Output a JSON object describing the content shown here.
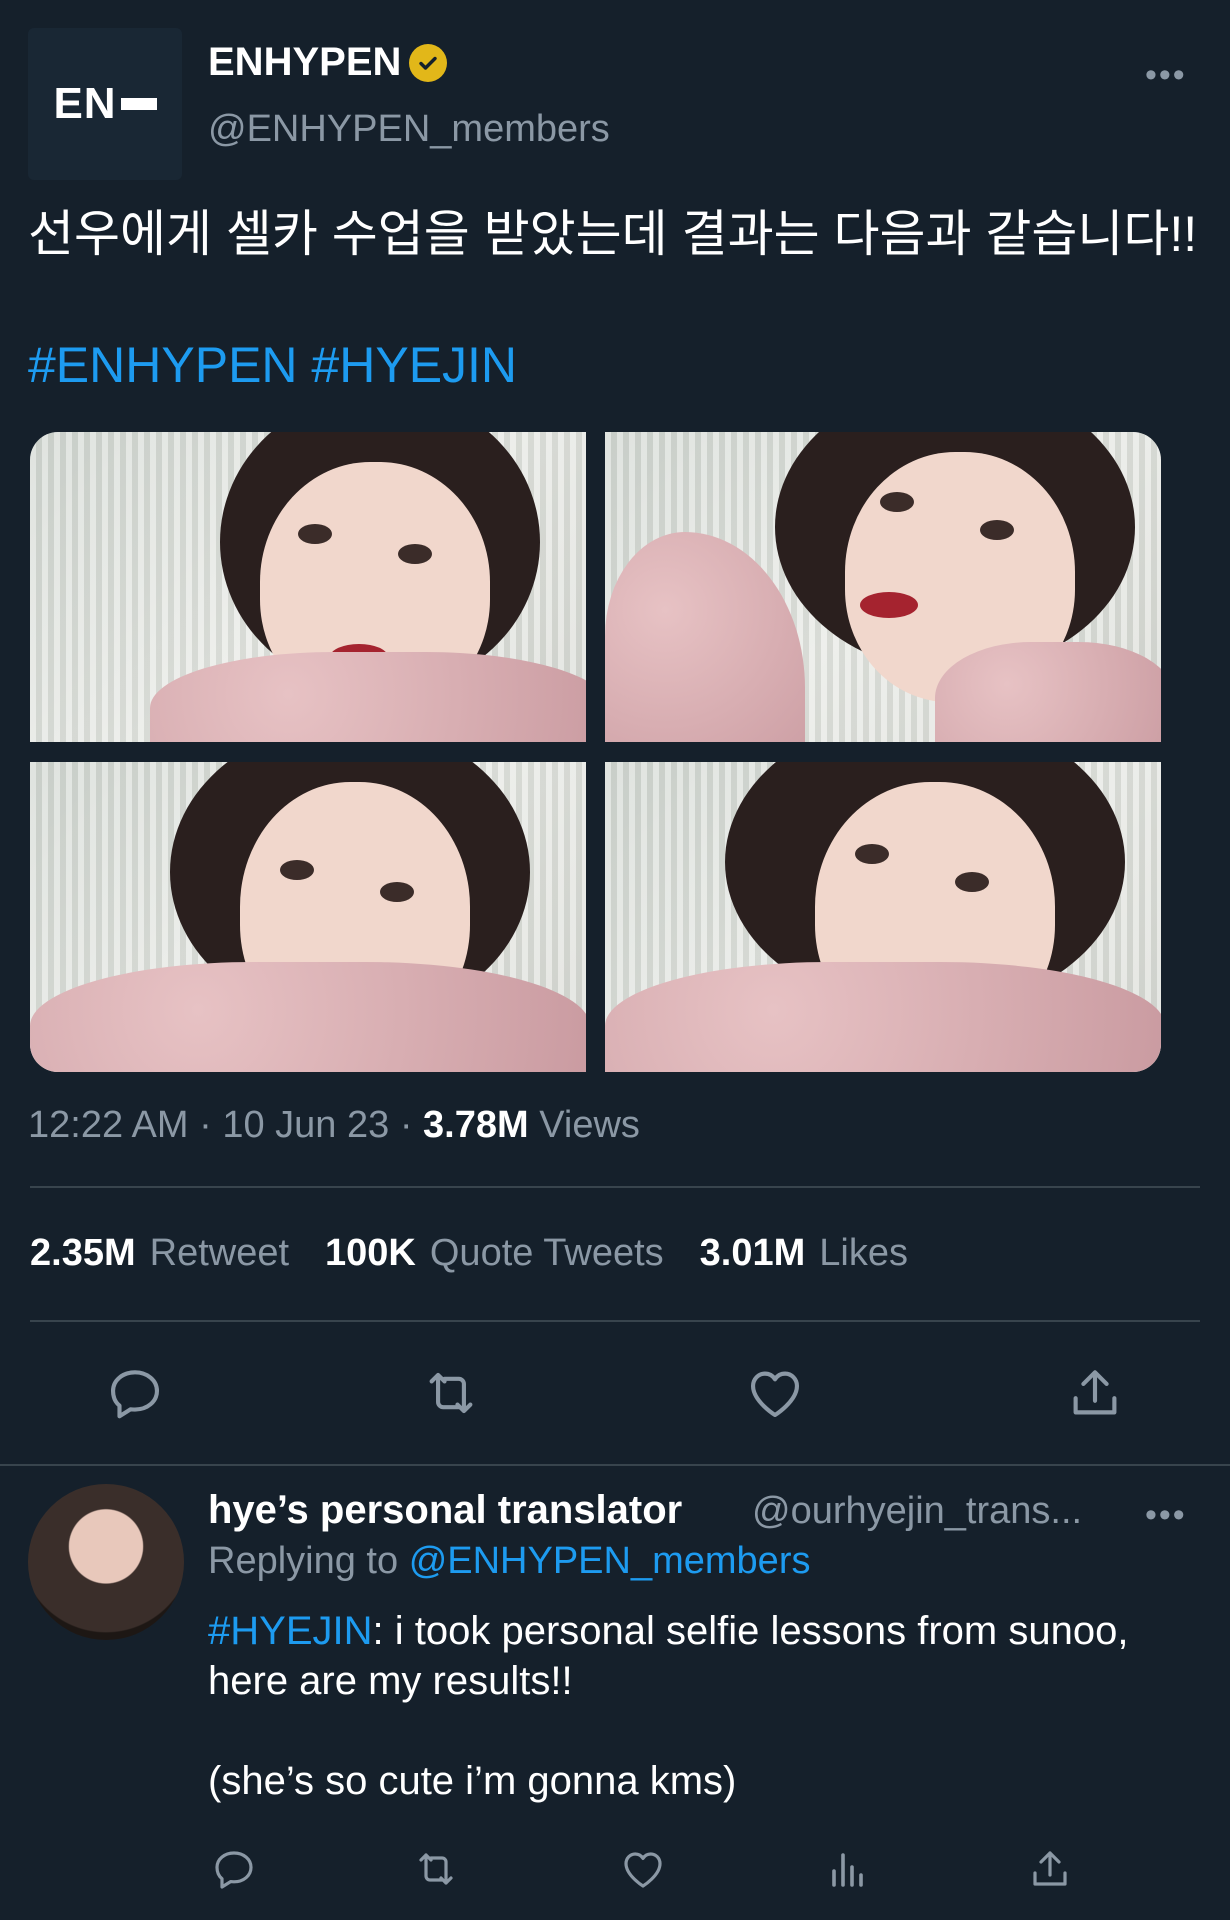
{
  "tweet": {
    "display_name": "ENHYPEN",
    "handle": "@ENHYPEN_members",
    "avatar_logo": "EN",
    "more_glyph": "•••",
    "text": "선우에게 셀카 수업을 받았는데 결과는 다음과 같습니다!!",
    "hashtags": "#ENHYPEN #HYEJIN",
    "time": "12:22 AM",
    "date": "10 Jun 23",
    "views_count": "3.78M",
    "views_label": "Views",
    "separator": "·",
    "images": 4
  },
  "stats": {
    "retweets_count": "2.35M",
    "retweets_label": "Retweet",
    "quotes_count": "100K",
    "quotes_label": "Quote Tweets",
    "likes_count": "3.01M",
    "likes_label": "Likes"
  },
  "actions": [
    "reply-icon",
    "retweet-icon",
    "like-icon",
    "share-icon"
  ],
  "reply": {
    "display_name": "hye’s personal translator",
    "handle": "@ourhyejin_trans...",
    "more_glyph": "•••",
    "replying_prefix": "Replying to",
    "replying_to": "@ENHYPEN_members",
    "hashtag": "#HYEJIN",
    "line1": ": i took personal selfie lessons from sunoo, here are my results!!",
    "line2": "(she’s so cute i’m gonna kms)",
    "actions": [
      "reply-icon",
      "retweet-icon",
      "like-icon",
      "views-icon",
      "share-icon"
    ]
  },
  "colors": {
    "background": "#15202b",
    "accent": "#1d9bf0",
    "muted": "#8b98a5",
    "verified": "#e2b719"
  }
}
